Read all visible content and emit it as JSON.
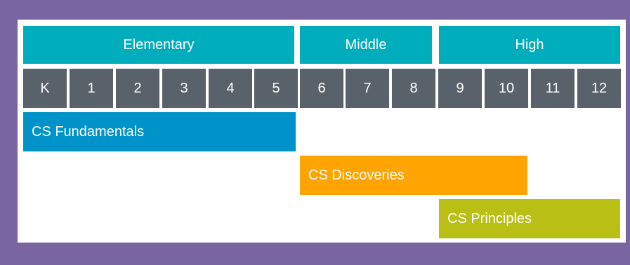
{
  "levels": {
    "elementary": "Elementary",
    "middle": "Middle",
    "high": "High"
  },
  "grades": [
    "K",
    "1",
    "2",
    "3",
    "4",
    "5",
    "6",
    "7",
    "8",
    "9",
    "10",
    "11",
    "12"
  ],
  "courses": {
    "fundamentals": "CS Fundamentals",
    "discoveries": "CS Discoveries",
    "principles": "CS Principles"
  },
  "colors": {
    "frame": "#7a65a3",
    "level_band": "#00adbc",
    "grade_cell": "#59616a",
    "fundamentals": "#0093c9",
    "discoveries": "#ffa400",
    "principles": "#b9bf15"
  }
}
